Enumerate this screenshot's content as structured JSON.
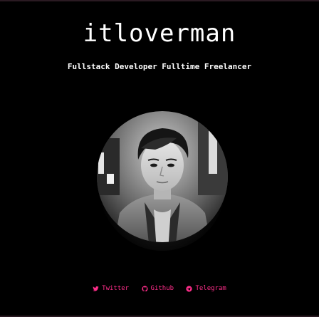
{
  "site": {
    "title": "itloverman",
    "tagline": "Fullstack Developer Fulltime Freelancer"
  },
  "avatar": {
    "icon": "portrait-photo-icon"
  },
  "social": {
    "links": [
      {
        "label": "Twitter",
        "icon": "twitter-icon"
      },
      {
        "label": "Github",
        "icon": "github-icon"
      },
      {
        "label": "Telegram",
        "icon": "telegram-icon"
      }
    ]
  },
  "colors": {
    "background": "#000000",
    "accent": "#ff2d8a",
    "text": "#ffffff"
  }
}
